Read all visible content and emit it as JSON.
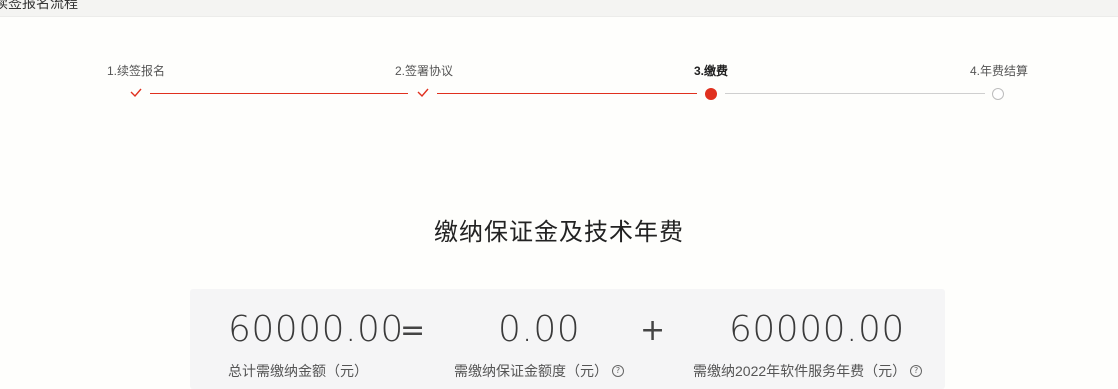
{
  "header": {
    "title": "续签报名流程"
  },
  "steps": [
    {
      "label": "1.续签报名",
      "state": "done"
    },
    {
      "label": "2.签署协议",
      "state": "done"
    },
    {
      "label": "3.缴费",
      "state": "current"
    },
    {
      "label": "4.年费结算",
      "state": "todo"
    }
  ],
  "colors": {
    "accent": "#e0301e",
    "inactive": "#cfcfcf"
  },
  "section": {
    "title": "缴纳保证金及技术年费"
  },
  "summary": {
    "total": {
      "value": "60000.00",
      "label": "总计需缴纳金额（元）"
    },
    "equals": "=",
    "deposit": {
      "value": "0.00",
      "label": "需缴纳保证金额度（元）"
    },
    "plus": "+",
    "annual_fee": {
      "value": "60000.00",
      "label": "需缴纳2022年软件服务年费（元）"
    }
  },
  "icons": {
    "step_done": "check-icon",
    "step_current": "filled-dot-icon",
    "step_todo": "empty-circle-icon",
    "help": "question-circle-icon"
  }
}
